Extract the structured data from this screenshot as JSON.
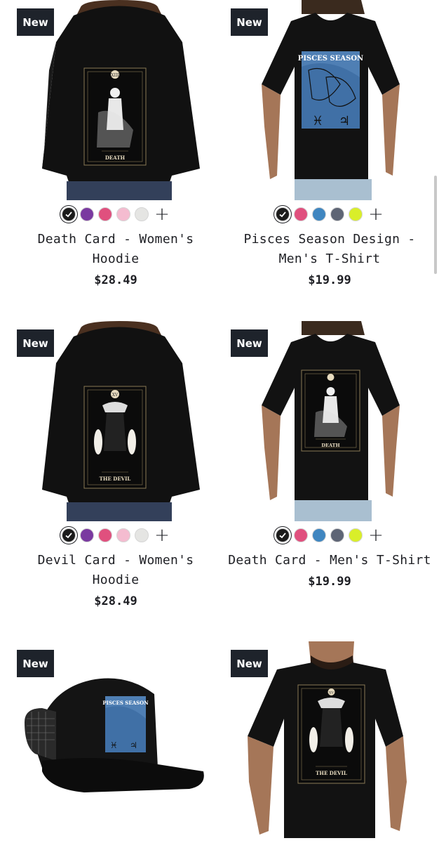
{
  "badge_text": "New",
  "products": [
    {
      "title": "Death Card - Women's Hoodie",
      "price": "$28.49",
      "garment": "hoodie",
      "design": "DEATH",
      "swatches": [
        "#1b1b1b",
        "#7a3aa0",
        "#e0507e",
        "#f4bcd0",
        "#e5e5e3"
      ]
    },
    {
      "title": "Pisces Season Design - Men's T-Shirt",
      "price": "$19.99",
      "garment": "tshirt",
      "design": "PISCES SEASON",
      "swatches": [
        "#1b1b1b",
        "#e0507e",
        "#3f86c0",
        "#5e6575",
        "#d9ee2a"
      ]
    },
    {
      "title": "Devil Card - Women's Hoodie",
      "price": "$28.49",
      "garment": "hoodie",
      "design": "THE DEVIL",
      "swatches": [
        "#1b1b1b",
        "#7a3aa0",
        "#e0507e",
        "#f4bcd0",
        "#e5e5e3"
      ]
    },
    {
      "title": "Death Card - Men's T-Shirt",
      "price": "$19.99",
      "garment": "tshirt",
      "design": "DEATH",
      "swatches": [
        "#1b1b1b",
        "#e0507e",
        "#3f86c0",
        "#5e6575",
        "#d9ee2a"
      ]
    },
    {
      "garment": "cap",
      "design": "PISCES SEASON"
    },
    {
      "garment": "tshirt-large",
      "design": "THE DEVIL"
    }
  ],
  "colors": {
    "badge_bg": "#1e232b",
    "text": "#1e1f24"
  }
}
